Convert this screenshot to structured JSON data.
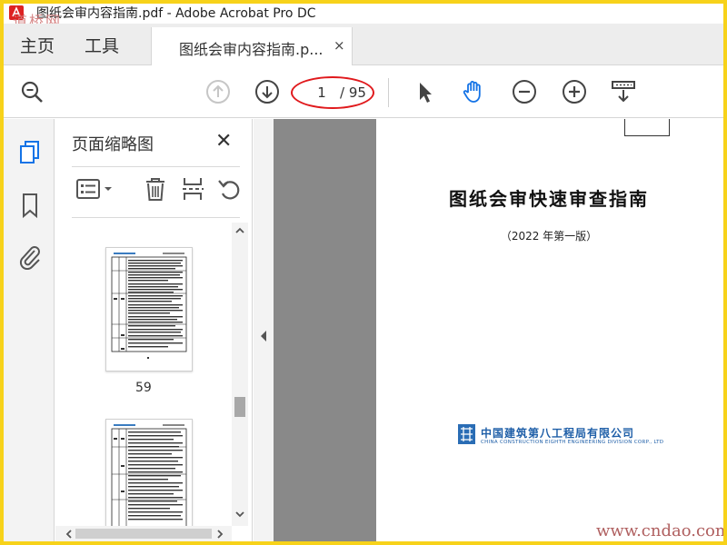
{
  "window": {
    "title": "图纸会审内容指南.pdf - Adobe Acrobat Pro DC",
    "watermark_top": "道桥网"
  },
  "tabs": {
    "home": "主页",
    "tools": "工具",
    "document": "图纸会审内容指南.p...",
    "close": "×"
  },
  "toolbar": {
    "current_page": "1",
    "total_pages": "/ 95",
    "icons": [
      "search-icon",
      "previous-page-icon",
      "next-page-icon",
      "select-tool-icon",
      "hand-tool-icon",
      "zoom-out-icon",
      "zoom-in-icon",
      "scroll-mode-icon"
    ]
  },
  "left_rail": {
    "icons": [
      "page-thumbnails-icon",
      "bookmarks-icon",
      "attachments-icon"
    ]
  },
  "thumbnail_panel": {
    "title": "页面缩略图",
    "close": "✕",
    "thumbnails": [
      {
        "label": "59"
      },
      {
        "label": ""
      }
    ]
  },
  "document": {
    "title": "图纸会审快速审查指南",
    "subtitle": "（2022 年第一版）",
    "company_cn": "中国建筑第八工程局有限公司",
    "company_en": "CHINA CONSTRUCTION EIGHTH ENGINEERING DIVISION CORP., LTD"
  },
  "watermark_bottom": "www.cndao.com",
  "colors": {
    "border": "#f7d21a",
    "annotation_red": "#e0191c",
    "accent_blue": "#1473e6",
    "company_blue": "#1f5fa8"
  }
}
